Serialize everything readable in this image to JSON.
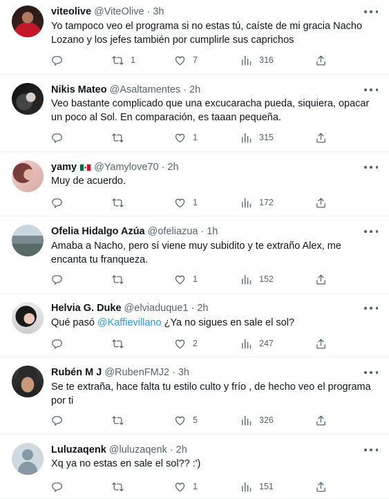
{
  "tweets": [
    {
      "name": "viteolive",
      "handle": "@ViteOlive",
      "dot": "·",
      "time": "3h",
      "text": "Yo tampoco veo el programa si no estas tú, caíste de mi gracia Nacho Lozano y los jefes también por cumplirle sus caprichos",
      "retweets": "1",
      "likes": "7",
      "views": "316",
      "avatar": "avatar-photo-woman-red"
    },
    {
      "name": "Nikis Mateo",
      "handle": "@Asaltamentes",
      "dot": "·",
      "time": "2h",
      "text": "Veo bastante complicado que una excucaracha pueda, siquiera,  opacar un poco al Sol. En comparación, es taaan pequeña.",
      "retweets": "",
      "likes": "1",
      "views": "315",
      "avatar": "avatar-photo-dark"
    },
    {
      "name": "yamy",
      "flag": "mexico-flag-icon",
      "handle": "@Yamylove70",
      "dot": "·",
      "time": "2h",
      "text": "Muy de acuerdo.",
      "retweets": "",
      "likes": "1",
      "views": "172",
      "avatar": "avatar-photo-woman-pink"
    },
    {
      "name": "Ofelia Hidalgo Azúa",
      "handle": "@ofeliazua",
      "dot": "·",
      "time": "1h",
      "text": "Amaba a Nacho, pero sí viene muy subidito y te extraño Alex, me encanta tu franqueza.",
      "retweets": "",
      "likes": "1",
      "views": "152",
      "avatar": "avatar-photo-building"
    },
    {
      "name": "Helvia G. Duke",
      "handle": "@elviaduque1",
      "dot": "·",
      "time": "2h",
      "text_before": "Qué pasó ",
      "mention": "@Kaffievillano",
      "text_after": " ¿Ya no sigues en sale el sol?",
      "retweets": "",
      "likes": "2",
      "views": "247",
      "avatar": "avatar-photo-woman-dark-hair"
    },
    {
      "name": "Rubén M J",
      "handle": "@RubenFMJ2",
      "dot": "·",
      "time": "3h",
      "text": "Se te extraña, hace falta tu estilo culto y frío , de hecho veo el programa por ti",
      "retweets": "",
      "likes": "5",
      "views": "326",
      "avatar": "avatar-photo-man-glasses"
    },
    {
      "name": "Luluzaqenk",
      "handle": "@luluzaqenk",
      "dot": "·",
      "time": "2h",
      "text": "Xq ya no estas en sale el sol?? :')",
      "retweets": "",
      "likes": "1",
      "views": "151",
      "avatar": "default-avatar-icon"
    }
  ],
  "colors": {
    "text": "#0f1419",
    "secondary": "#536471",
    "link": "#1d9bf0",
    "divider": "#eff3f4"
  }
}
